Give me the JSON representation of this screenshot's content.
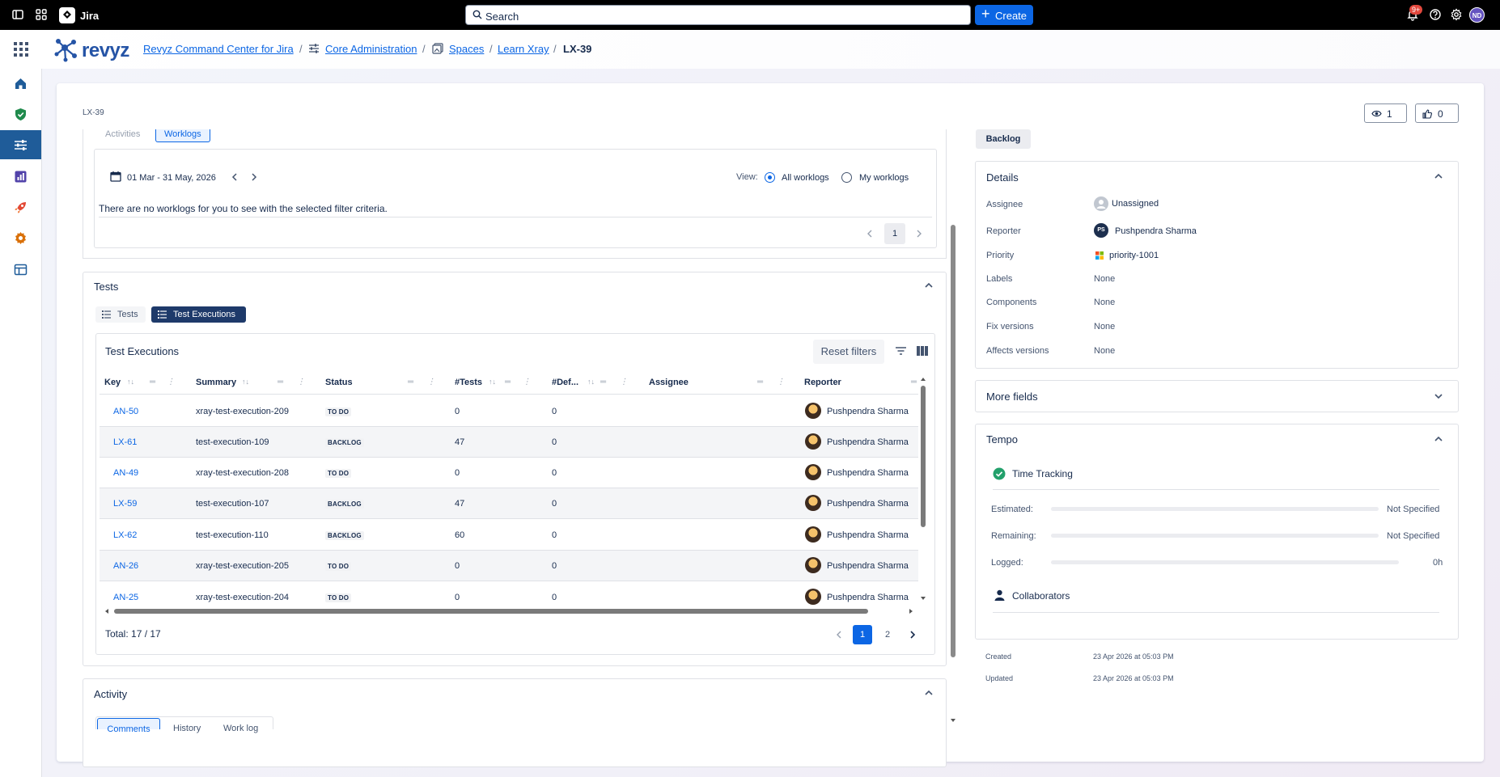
{
  "topbar": {
    "app_name": "Jira",
    "search_placeholder": "Search",
    "create_label": "Create",
    "notif_count": "9+",
    "user_initials": "ND"
  },
  "header": {
    "brand": "revyz",
    "breadcrumbs": [
      "Revyz Command Center for Jira",
      "Core Administration",
      "Spaces",
      "Learn Xray"
    ],
    "current": "LX-39"
  },
  "issue": {
    "key": "LX-39",
    "watchers": "1",
    "votes": "0",
    "status": "Backlog"
  },
  "worklogs": {
    "tabs": [
      "Activities",
      "Worklogs"
    ],
    "date_range": "01 Mar - 31 May, 2026",
    "view_label": "View:",
    "options": [
      "All worklogs",
      "My worklogs"
    ],
    "empty_message": "There are no worklogs for you to see with the selected filter criteria.",
    "page": "1"
  },
  "tests": {
    "title": "Tests",
    "tabs": [
      "Tests",
      "Test Executions"
    ],
    "panel_title": "Test Executions",
    "reset_label": "Reset filters",
    "columns": [
      "Key",
      "Summary",
      "Status",
      "#Tests",
      "#Def...",
      "Assignee",
      "Reporter"
    ],
    "rows": [
      {
        "key": "AN-50",
        "summary": "xray-test-execution-209",
        "status": "TO DO",
        "tests": "0",
        "defects": "0",
        "assignee": "",
        "reporter": "Pushpendra Sharma"
      },
      {
        "key": "LX-61",
        "summary": "test-execution-109",
        "status": "BACKLOG",
        "tests": "47",
        "defects": "0",
        "assignee": "",
        "reporter": "Pushpendra Sharma"
      },
      {
        "key": "AN-49",
        "summary": "xray-test-execution-208",
        "status": "TO DO",
        "tests": "0",
        "defects": "0",
        "assignee": "",
        "reporter": "Pushpendra Sharma"
      },
      {
        "key": "LX-59",
        "summary": "test-execution-107",
        "status": "BACKLOG",
        "tests": "47",
        "defects": "0",
        "assignee": "",
        "reporter": "Pushpendra Sharma"
      },
      {
        "key": "LX-62",
        "summary": "test-execution-110",
        "status": "BACKLOG",
        "tests": "60",
        "defects": "0",
        "assignee": "",
        "reporter": "Pushpendra Sharma"
      },
      {
        "key": "AN-26",
        "summary": "xray-test-execution-205",
        "status": "TO DO",
        "tests": "0",
        "defects": "0",
        "assignee": "",
        "reporter": "Pushpendra Sharma"
      },
      {
        "key": "AN-25",
        "summary": "xray-test-execution-204",
        "status": "TO DO",
        "tests": "0",
        "defects": "0",
        "assignee": "",
        "reporter": "Pushpendra Sharma"
      }
    ],
    "total": "Total: 17 / 17",
    "pages": [
      "1",
      "2"
    ]
  },
  "activity": {
    "title": "Activity",
    "tabs": [
      "Comments",
      "History",
      "Work log"
    ]
  },
  "details": {
    "title": "Details",
    "fields": [
      {
        "label": "Assignee",
        "value": "Unassigned"
      },
      {
        "label": "Reporter",
        "value": "Pushpendra Sharma"
      },
      {
        "label": "Priority",
        "value": "priority-1001"
      },
      {
        "label": "Labels",
        "value": "None"
      },
      {
        "label": "Components",
        "value": "None"
      },
      {
        "label": "Fix versions",
        "value": "None"
      },
      {
        "label": "Affects versions",
        "value": "None"
      }
    ],
    "reporter_initials": "PS"
  },
  "more_fields": {
    "title": "More fields"
  },
  "tempo": {
    "title": "Tempo",
    "time_tracking": "Time Tracking",
    "rows": [
      {
        "label": "Estimated:",
        "value": "Not Specified"
      },
      {
        "label": "Remaining:",
        "value": "Not Specified"
      },
      {
        "label": "Logged:",
        "value": "0h"
      }
    ],
    "collaborators": "Collaborators"
  },
  "meta": {
    "created_label": "Created",
    "created_value": "23 Apr 2026 at 05:03 PM",
    "updated_label": "Updated",
    "updated_value": "23 Apr 2026 at 05:03 PM"
  },
  "colors": {
    "brand_blue": "#0c66e4",
    "sidebar_active": "#1f5c99",
    "success_green": "#22a06b"
  }
}
